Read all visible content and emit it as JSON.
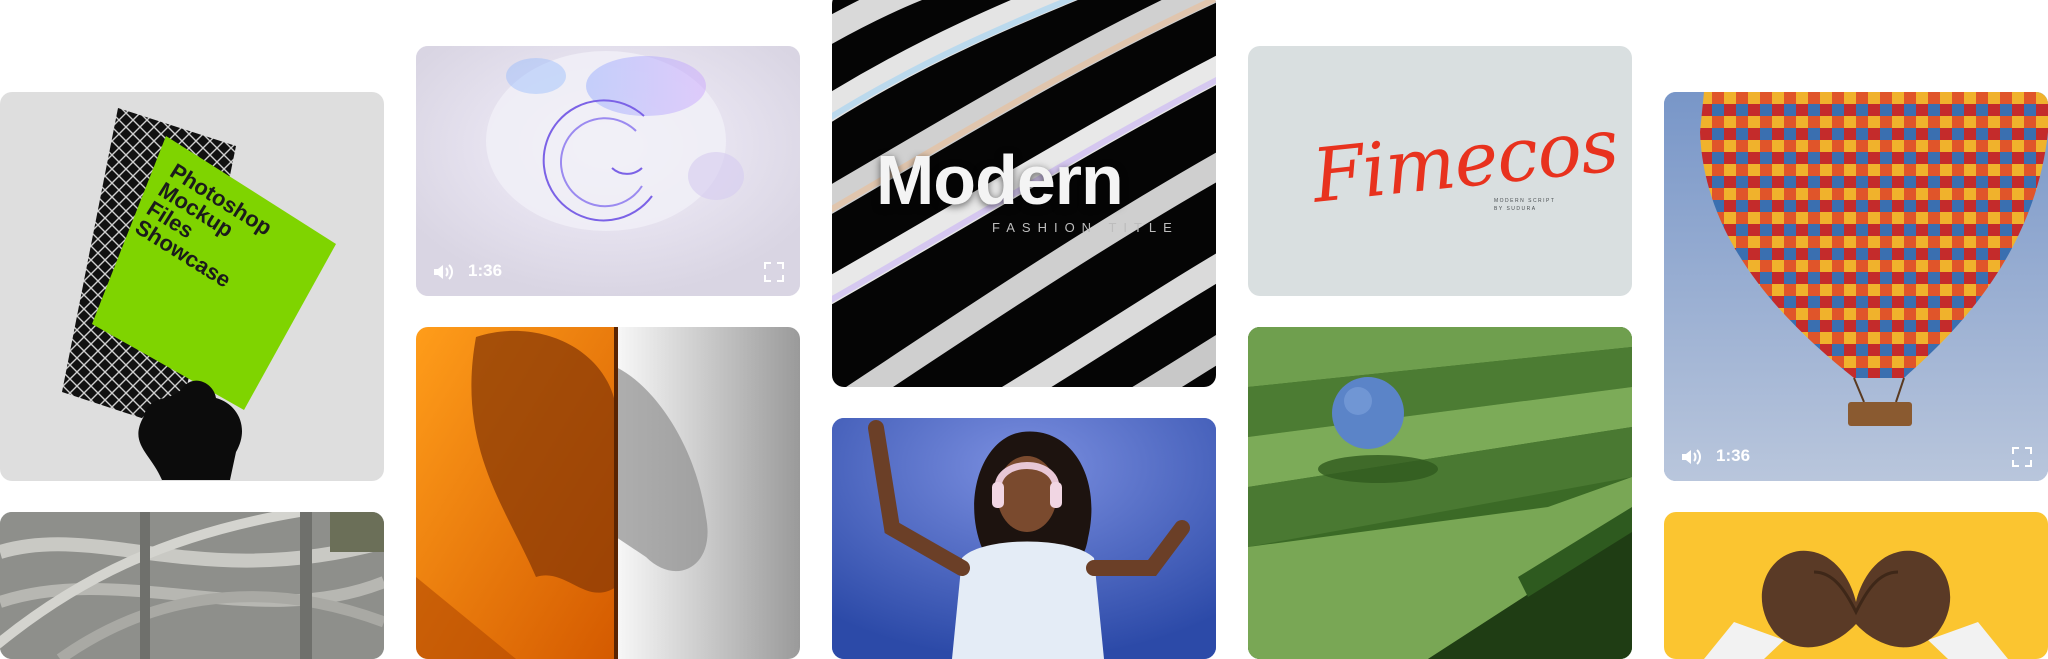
{
  "tiles": {
    "mockup": {
      "poster_text": "Photoshop\nMockup\nFiles\nShowcase"
    },
    "abstract_video": {
      "duration": "1:36",
      "icons": [
        "volume-icon",
        "fullscreen-icon"
      ]
    },
    "modern_title": {
      "title": "Modern",
      "subtitle": "FASHION TITLE"
    },
    "fimecos_font": {
      "title": "Fimecos",
      "subtitle_line1": "MODERN SCRIPT",
      "subtitle_line2": "BY SUDURA"
    },
    "balloon_video": {
      "duration": "1:36",
      "icons": [
        "volume-icon",
        "fullscreen-icon"
      ]
    }
  },
  "colors": {
    "mockup_bg": "#dcdcdc",
    "mockup_green": "#7fd400",
    "fimecos_bg": "#d9dfe0",
    "fimecos_red": "#e8321e",
    "heart_bg": "#fbc530",
    "sky_blue": "#7f9ac8"
  }
}
